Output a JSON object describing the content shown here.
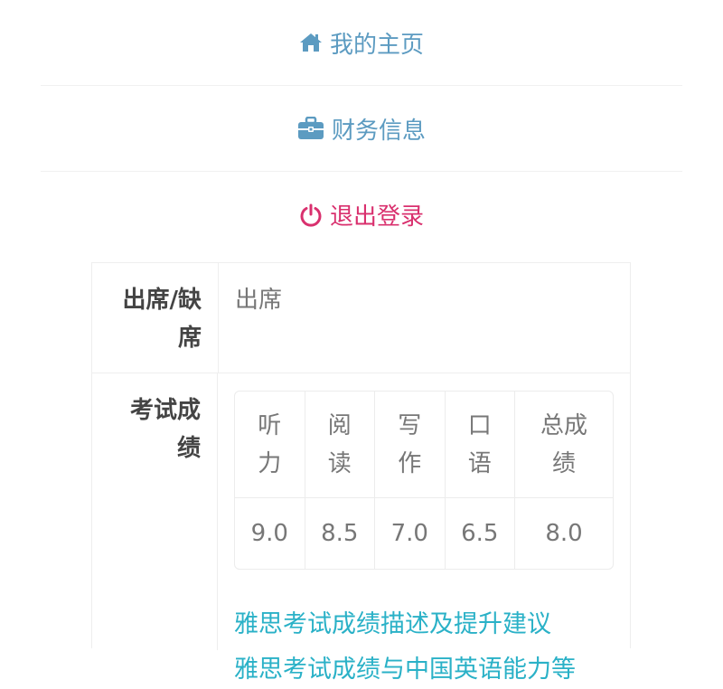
{
  "menu": {
    "items": [
      {
        "label": "我的主页",
        "icon": "home-icon",
        "color": "#5c9bc1"
      },
      {
        "label": "财务信息",
        "icon": "briefcase-icon",
        "color": "#5c9bc1"
      },
      {
        "label": "退出登录",
        "icon": "power-icon",
        "color": "#d9306e"
      }
    ]
  },
  "detail": {
    "attendance": {
      "label": "出席/缺席",
      "value": "出席"
    },
    "exam": {
      "label": "考试成绩",
      "headers": [
        "听力",
        "阅读",
        "写作",
        "口语",
        "总成绩"
      ],
      "scores": [
        "9.0",
        "8.5",
        "7.0",
        "6.5",
        "8.0"
      ]
    },
    "links": {
      "description": "雅思考试成绩描述及提升建议",
      "partial": "雅思考试成绩与中国英语能力等"
    }
  }
}
